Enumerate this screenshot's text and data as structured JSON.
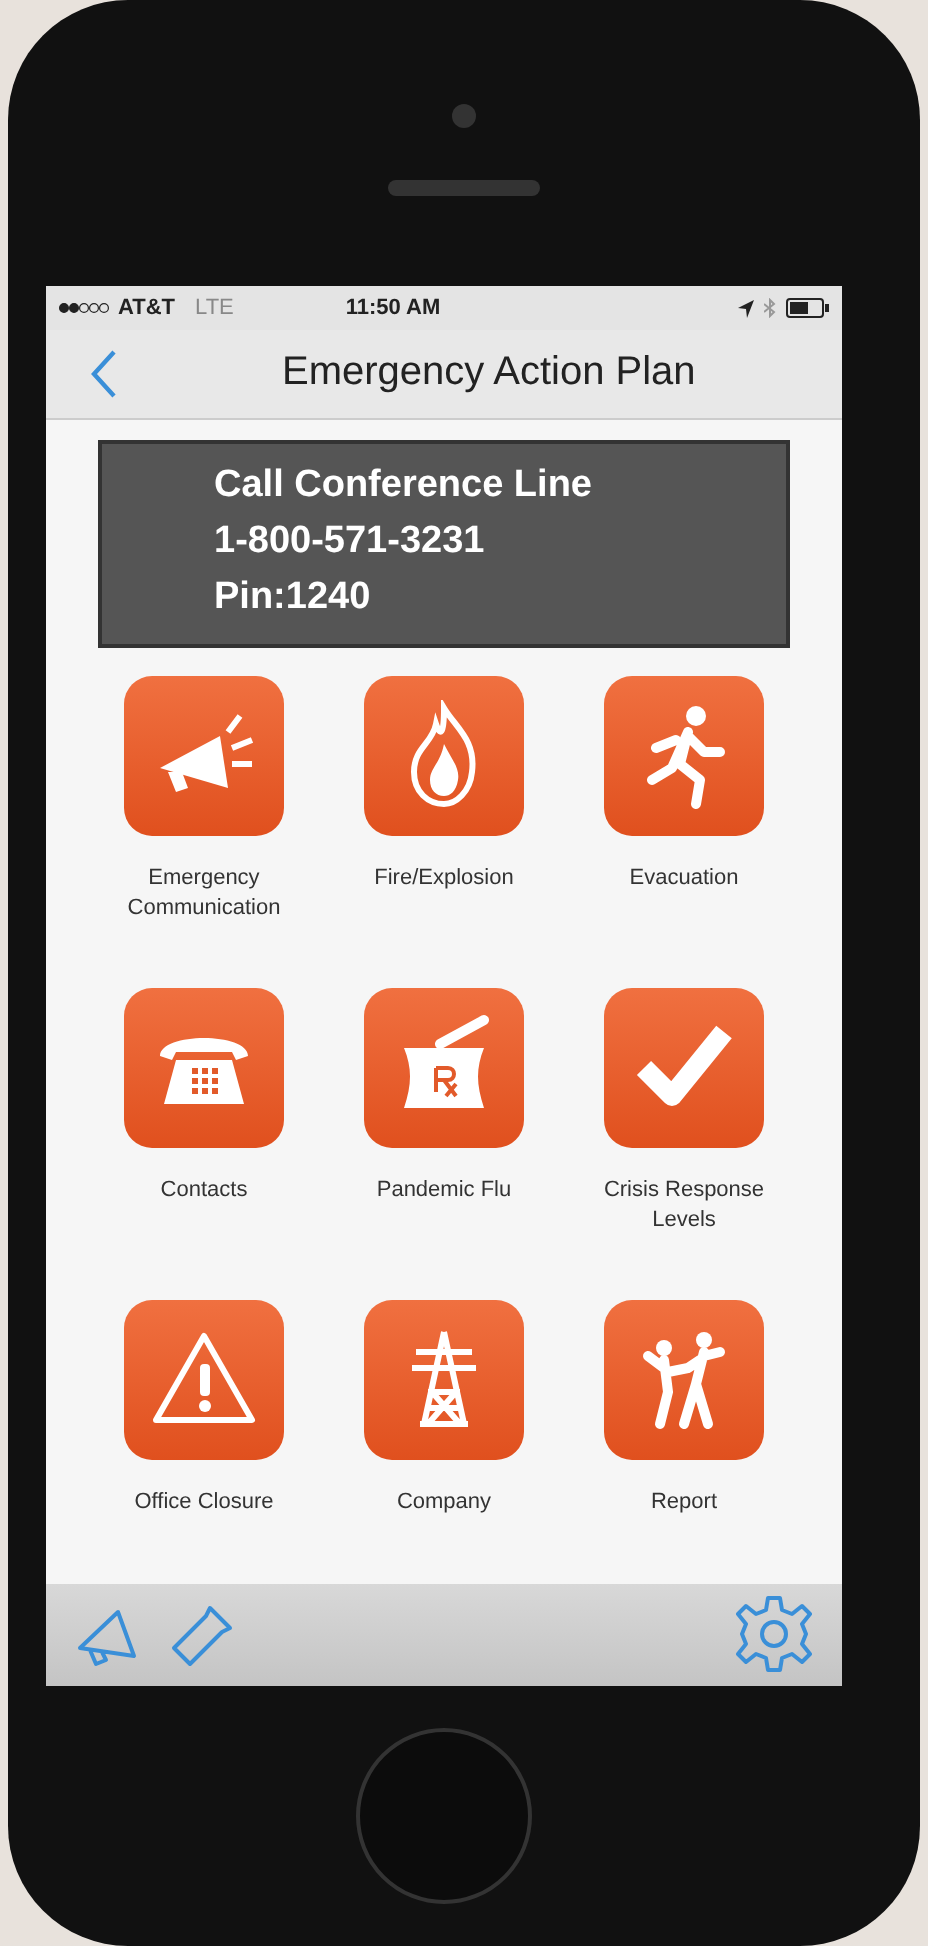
{
  "status_bar": {
    "carrier": "AT&T",
    "network": "LTE",
    "time": "11:50 AM"
  },
  "nav": {
    "title": "Emergency Action Plan"
  },
  "conference": {
    "lines": [
      "Call Conference Line",
      "1-800-571-3231",
      "Pin:1240"
    ]
  },
  "tiles": [
    {
      "label": "Emergency Communication",
      "kind": "megaphone"
    },
    {
      "label": "Fire/Explosion",
      "kind": "fire"
    },
    {
      "label": "Evacuation",
      "kind": "runner"
    },
    {
      "label": "Contacts",
      "kind": "phone"
    },
    {
      "label": "Pandemic Flu",
      "kind": "mortar"
    },
    {
      "label": "Crisis Response Levels",
      "kind": "check"
    },
    {
      "label": "Office Closure",
      "kind": "warning"
    },
    {
      "label": "Company",
      "kind": "tower"
    },
    {
      "label": "Report",
      "kind": "people"
    }
  ]
}
